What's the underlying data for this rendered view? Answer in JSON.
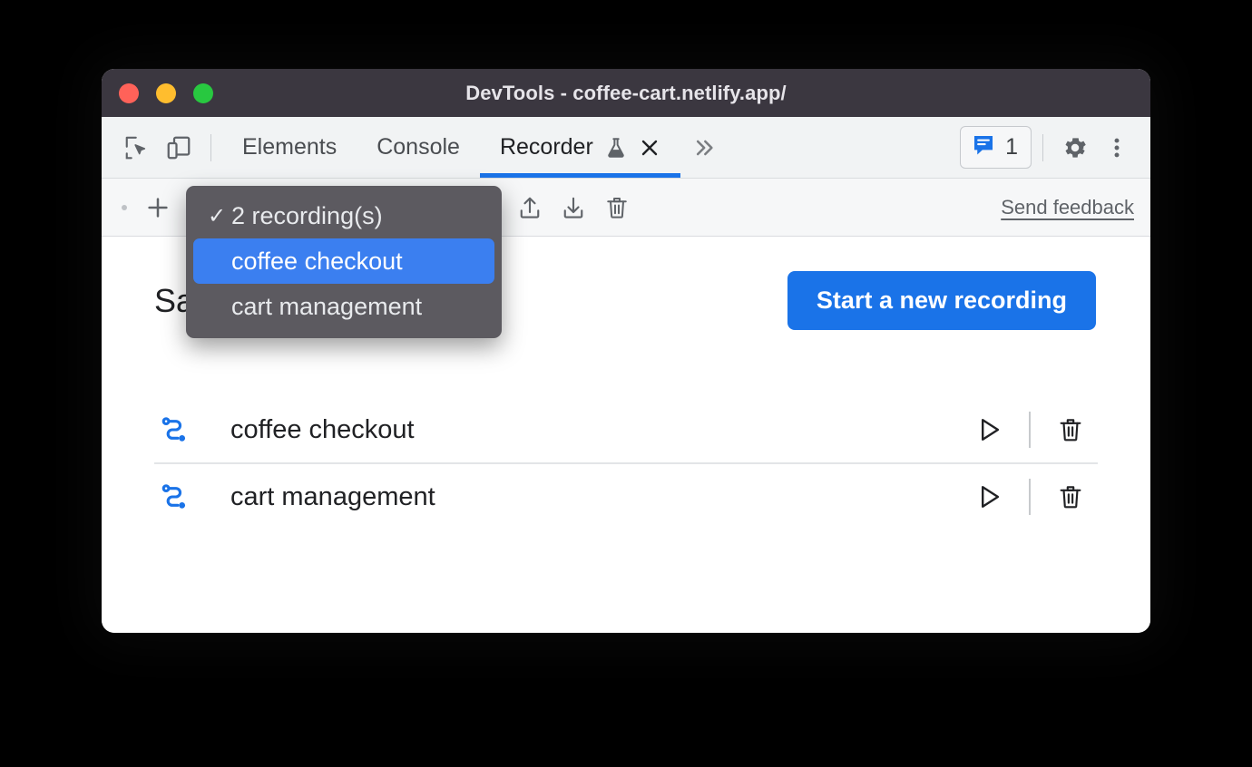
{
  "window": {
    "title": "DevTools - coffee-cart.netlify.app/",
    "traffic_lights": [
      "close-red",
      "minimize-amber",
      "maximize-green"
    ],
    "colors": {
      "titlebar_bg": "#3b3740",
      "accent_blue": "#1a73e8",
      "menu_bg": "#5c5a60",
      "menu_selected": "#3b7ff0",
      "page_bg": "#ffffff"
    }
  },
  "tabbar": {
    "inspect_icon": "inspect-cursor-icon",
    "device_icon": "device-toolbar-icon",
    "tabs": [
      {
        "label": "Elements",
        "active": false
      },
      {
        "label": "Console",
        "active": false
      },
      {
        "label": "Recorder",
        "active": true,
        "experiment_icon": "flask-icon",
        "close_icon": "close-icon"
      }
    ],
    "more_tabs_icon": "chevron-double-right-icon",
    "issues": {
      "icon": "issues-message-icon",
      "count": "1"
    },
    "settings_icon": "gear-icon",
    "overflow_icon": "more-vertical-icon"
  },
  "recorder_toolbar": {
    "add_icon": "plus-icon",
    "selected_recording": "coffee checkout",
    "export_icon": "export-upload-icon",
    "import_icon": "import-download-icon",
    "delete_icon": "trash-icon",
    "feedback_label": "Send feedback"
  },
  "dropdown": {
    "header": {
      "label": "2 recording(s)",
      "checked": true,
      "check_glyph": "✓"
    },
    "items": [
      {
        "label": "coffee checkout",
        "selected": true
      },
      {
        "label": "cart management",
        "selected": false
      }
    ]
  },
  "panel": {
    "title": "Saved recordings",
    "start_button": "Start a new recording",
    "recordings": [
      {
        "icon": "recording-flow-icon",
        "name": "coffee checkout",
        "play_icon": "play-icon",
        "delete_icon": "trash-icon"
      },
      {
        "icon": "recording-flow-icon",
        "name": "cart management",
        "play_icon": "play-icon",
        "delete_icon": "trash-icon"
      }
    ]
  }
}
